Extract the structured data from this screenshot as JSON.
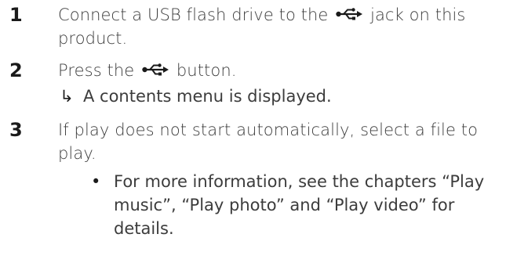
{
  "steps": [
    {
      "number": "1",
      "text_before_icon": "Connect a USB flash drive to the",
      "icon": "usb-icon",
      "text_after_icon": "jack on this product."
    },
    {
      "number": "2",
      "text_before_icon": "Press the",
      "icon": "usb-icon",
      "text_after_icon": "button.",
      "result_arrow": "↳",
      "result_text": "A contents menu is displayed."
    },
    {
      "number": "3",
      "text": "If play does not start automatically, select a file to play.",
      "bullet_marker": "•",
      "bullet_text": "For more information, see the chapters “Play music”, “Play photo” and “Play video” for details."
    }
  ]
}
